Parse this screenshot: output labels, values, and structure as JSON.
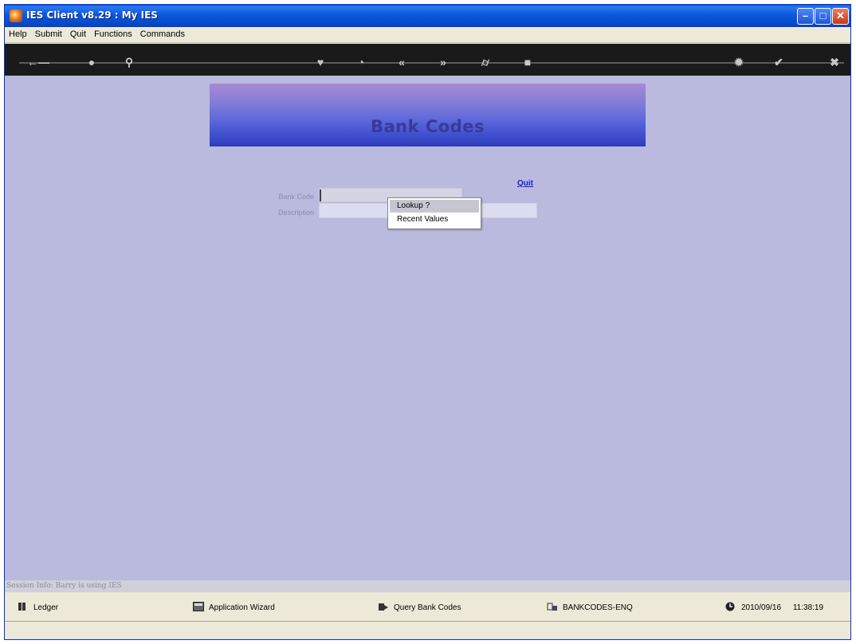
{
  "window": {
    "title": "IES Client v8.29 : My IES"
  },
  "menubar": {
    "items": [
      "Help",
      "Submit",
      "Quit",
      "Functions",
      "Commands"
    ]
  },
  "toolbar": {
    "icons": [
      "key-icon",
      "help-icon",
      "search-icon",
      "heart-icon",
      "clock-icon",
      "rewind-icon",
      "fast-forward-icon",
      "bracket-icon",
      "stop-icon",
      "gear-icon",
      "check-icon",
      "close-icon"
    ]
  },
  "banner": {
    "title": "Bank Codes"
  },
  "form": {
    "bank_code_label": "Bank Code",
    "description_label": "Description",
    "bank_code_value": "",
    "description_value": "",
    "quit_label": "Quit"
  },
  "context_menu": {
    "items": [
      "Lookup ?",
      "Recent Values"
    ]
  },
  "session": {
    "text": "Session Info: Barry is using IES"
  },
  "statusbar": {
    "ledger": "Ledger",
    "wizard": "Application Wizard",
    "query": "Query Bank Codes",
    "code": "BANKCODES-ENQ",
    "date": "2010/09/16",
    "time": "11:38:19"
  }
}
